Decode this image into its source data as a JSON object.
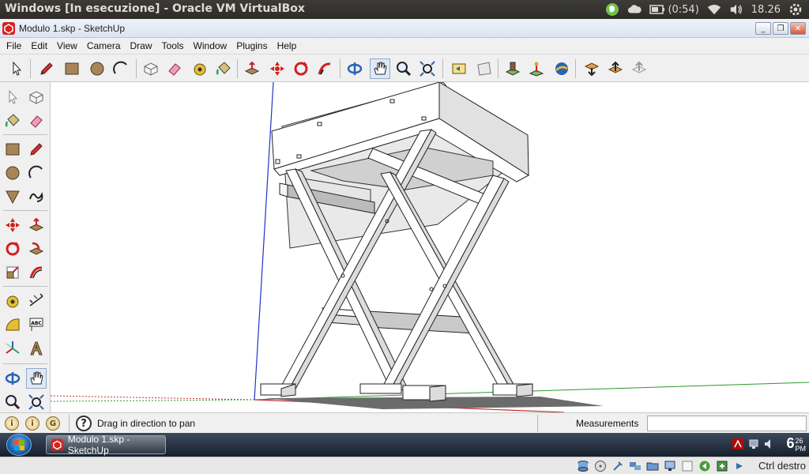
{
  "host": {
    "window_title": "Windows [In esecuzione] - Oracle VM VirtualBox",
    "tray": {
      "app_icon": "evernote-icon",
      "cloud_icon": "cloud-icon",
      "battery_text": "(0:54)",
      "wifi_icon": "wifi-icon",
      "volume_icon": "volume-icon",
      "time": "18.26",
      "settings_icon": "gear-icon"
    }
  },
  "app": {
    "title": "Modulo 1.skp - SketchUp",
    "window_buttons": [
      "_",
      "❐",
      "✕"
    ],
    "menu": [
      "File",
      "Edit",
      "View",
      "Camera",
      "Draw",
      "Tools",
      "Window",
      "Plugins",
      "Help"
    ],
    "toolbar_icons": [
      "select-icon",
      "pencil-icon",
      "rectangle-icon",
      "circle-icon",
      "arc-icon",
      "make-component-icon",
      "eraser-icon",
      "tape-measure-icon",
      "paint-bucket-icon",
      "push-pull-icon",
      "move-icon",
      "rotate-icon",
      "follow-me-icon",
      "orbit-icon",
      "pan-icon",
      "zoom-icon",
      "zoom-extents-icon",
      "previous-view-icon",
      "next-view-icon",
      "add-location-icon",
      "toggle-terrain-icon",
      "google-earth-icon",
      "get-models-icon",
      "share-model-icon",
      "share-component-icon"
    ],
    "left_toolbar_icons": [
      "select-icon",
      "make-component-icon",
      "paint-bucket-icon",
      "eraser-icon",
      "rectangle-icon",
      "pencil-icon",
      "circle-icon",
      "arc-icon",
      "polygon-icon",
      "freehand-icon",
      "move-icon",
      "push-pull-icon",
      "rotate-icon",
      "follow-me-icon",
      "scale-icon",
      "offset-icon",
      "tape-measure-icon",
      "dimension-icon",
      "protractor-icon",
      "text-icon",
      "axes-icon",
      "3d-text-icon",
      "orbit-icon",
      "pan-icon",
      "zoom-icon",
      "zoom-extents-icon"
    ],
    "left_text_label": "ABC",
    "status": {
      "icons": [
        "location-icon",
        "credit-icon",
        "google-icon"
      ],
      "credit_letter": "G",
      "help_symbol": "?",
      "message": "Drag in direction to pan",
      "measurements_label": "Measurements",
      "measurements_value": ""
    }
  },
  "taskbar": {
    "task_label": "Modulo 1.skp - SketchUp",
    "clock_hour": "6",
    "clock_minutes": "26",
    "clock_ampm": "PM"
  },
  "vbox": {
    "host_key": "Ctrl destro"
  }
}
